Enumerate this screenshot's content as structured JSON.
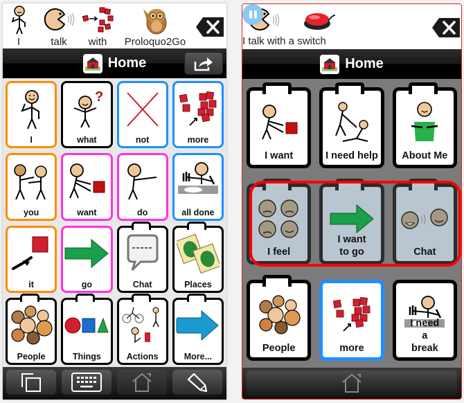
{
  "left_screen": {
    "message_bar": {
      "words": [
        {
          "label": "I",
          "icon": "person-pointing-self-icon"
        },
        {
          "label": "talk",
          "icon": "talking-head-icon"
        },
        {
          "label": "with",
          "icon": "red-squares-arrow-icon"
        },
        {
          "label": "Proloquo2Go",
          "icon": "owl-icon"
        }
      ],
      "clear_icon": "clear-message-icon"
    },
    "header": {
      "title": "Home",
      "title_icon": "house-icon",
      "share_icon": "share-icon"
    },
    "grid": {
      "cells": [
        {
          "label": "I",
          "border": "orange",
          "folder": false,
          "icon": "person-pointing-self-icon"
        },
        {
          "label": "what",
          "border": "black",
          "folder": false,
          "icon": "person-question-icon"
        },
        {
          "label": "not",
          "border": "blue",
          "folder": false,
          "icon": "red-x-icon"
        },
        {
          "label": "more",
          "border": "blue",
          "folder": false,
          "icon": "red-squares-icon"
        },
        {
          "label": "you",
          "border": "orange",
          "folder": false,
          "icon": "two-people-pointing-icon"
        },
        {
          "label": "want",
          "border": "magenta",
          "folder": false,
          "icon": "person-reaching-cube-icon"
        },
        {
          "label": "do",
          "border": "magenta",
          "folder": false,
          "icon": "person-reaching-icon"
        },
        {
          "label": "all done",
          "border": "blue",
          "folder": false,
          "icon": "person-empty-plate-icon"
        },
        {
          "label": "it",
          "border": "orange",
          "folder": false,
          "icon": "hand-pointing-square-icon"
        },
        {
          "label": "go",
          "border": "magenta",
          "folder": false,
          "icon": "green-arrow-icon"
        },
        {
          "label": "Chat",
          "border": "black",
          "folder": true,
          "icon": "speech-bubble-icon"
        },
        {
          "label": "Places",
          "border": "black",
          "folder": true,
          "icon": "maps-icon"
        },
        {
          "label": "People",
          "border": "black",
          "folder": true,
          "icon": "group-faces-icon"
        },
        {
          "label": "Things",
          "border": "black",
          "folder": true,
          "icon": "shapes-icon"
        },
        {
          "label": "Actions",
          "border": "black",
          "folder": true,
          "icon": "actions-icon"
        },
        {
          "label": "More...",
          "border": "black",
          "folder": true,
          "icon": "blue-arrow-icon"
        }
      ]
    },
    "toolbar": [
      {
        "name": "copy-button",
        "icon": "copy-icon"
      },
      {
        "name": "keyboard-button",
        "icon": "keyboard-icon"
      },
      {
        "name": "home-button",
        "icon": "home-icon",
        "disabled": true
      },
      {
        "name": "edit-button",
        "icon": "pencil-icon"
      }
    ]
  },
  "right_screen": {
    "message_bar": {
      "sentence": "I talk with a switch",
      "pause_icon": "pause-icon",
      "icons": [
        "talking-head-icon",
        "red-switch-button-icon"
      ],
      "clear_icon": "clear-message-icon"
    },
    "header": {
      "title": "Home",
      "title_icon": "house-icon"
    },
    "grid": {
      "cells": [
        {
          "label": "I want",
          "border": "black",
          "folder": true,
          "dim": false,
          "icon": "person-reaching-cube-icon"
        },
        {
          "label": "I need help",
          "border": "black",
          "folder": true,
          "dim": false,
          "icon": "person-helping-icon"
        },
        {
          "label": "About Me",
          "border": "black",
          "folder": true,
          "dim": false,
          "icon": "person-green-shirt-icon"
        },
        {
          "label": "I feel",
          "border": "black",
          "folder": true,
          "dim": true,
          "icon": "feeling-faces-icon"
        },
        {
          "label": "I want to go",
          "border": "black",
          "folder": true,
          "dim": true,
          "icon": "green-arrow-icon"
        },
        {
          "label": "Chat",
          "border": "black",
          "folder": true,
          "dim": true,
          "icon": "chatting-faces-icon"
        },
        {
          "label": "People",
          "border": "black",
          "folder": true,
          "dim": false,
          "icon": "group-faces-icon"
        },
        {
          "label": "more",
          "border": "blue",
          "folder": false,
          "dim": false,
          "icon": "red-squares-icon"
        },
        {
          "label": "I need a break",
          "border": "black",
          "folder": false,
          "dim": false,
          "icon": "person-empty-plate-icon"
        }
      ],
      "scan_highlight_row": 2
    },
    "toolbar": [
      {
        "name": "home-button",
        "icon": "home-icon",
        "disabled": true
      }
    ]
  },
  "colors": {
    "orange": "#ff8c00",
    "magenta": "#ff33dd",
    "blue": "#1f8fff",
    "black": "#000000",
    "scan_red": "#ff0000"
  }
}
